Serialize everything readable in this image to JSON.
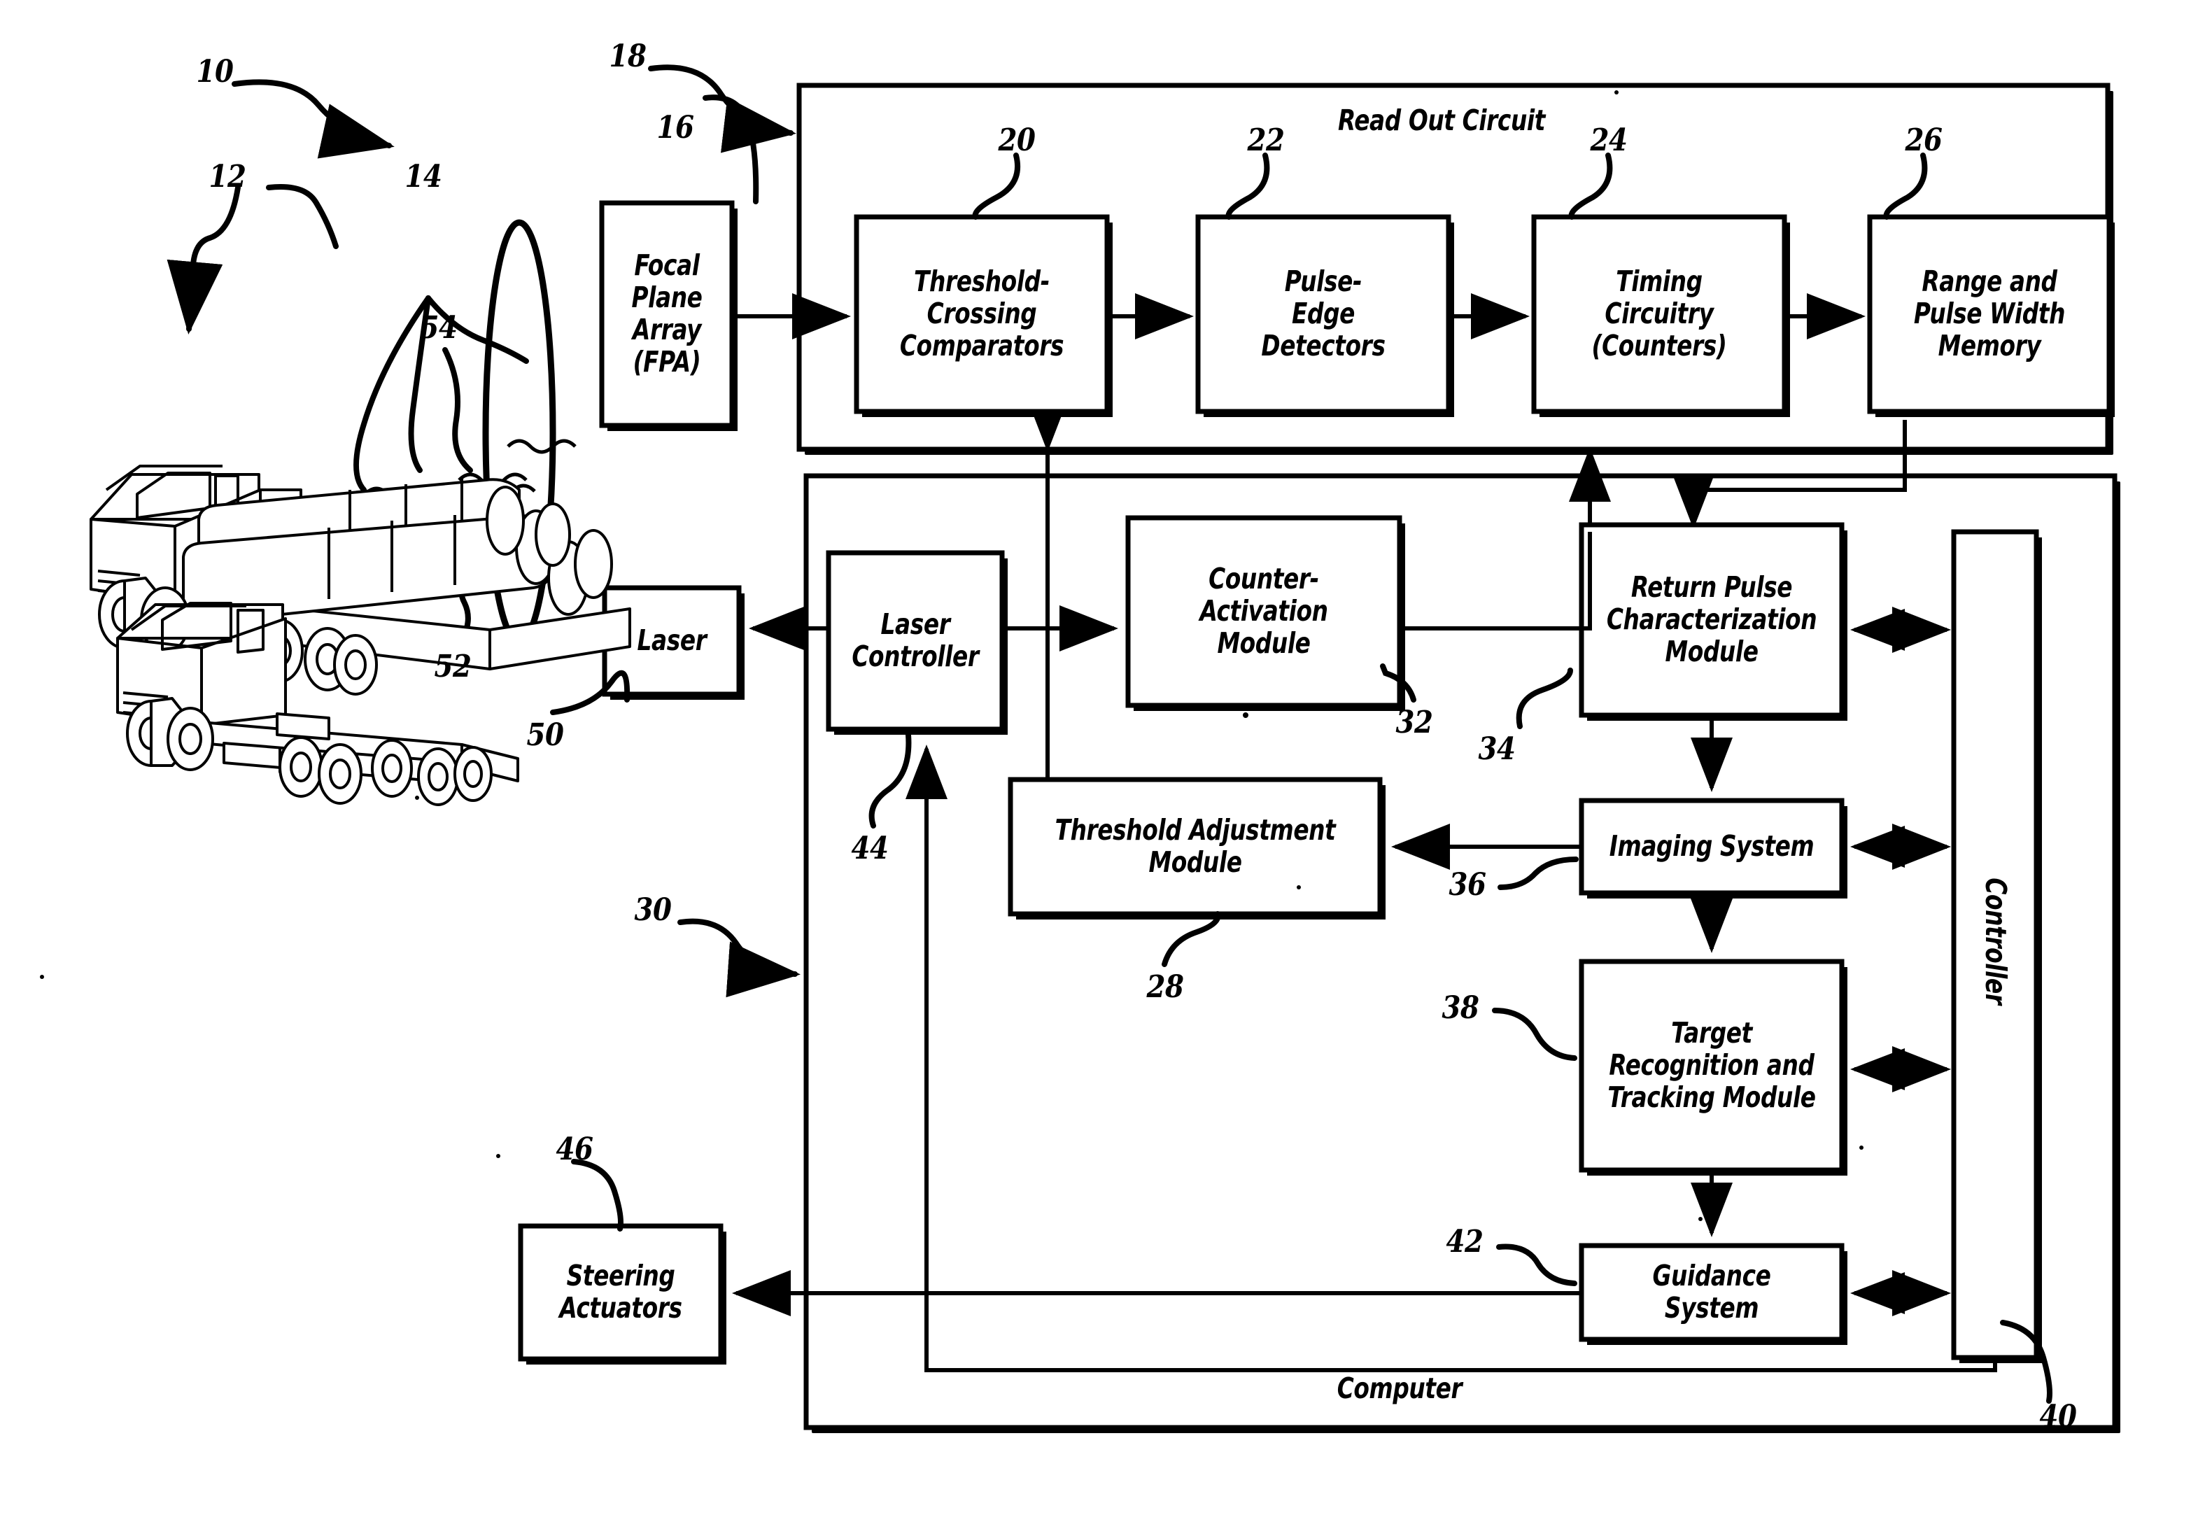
{
  "figure": {
    "domain": "patent-block-diagram",
    "line_color": "#000000",
    "background": "#ffffff"
  },
  "containers": [
    {
      "id": "read-out-circuit",
      "title": "Read Out Circuit",
      "ref": "18"
    },
    {
      "id": "computer",
      "title": "Computer",
      "ref": "30"
    }
  ],
  "blocks": [
    {
      "id": "fpa",
      "label": "Focal\nPlane\nArray\n(FPA)",
      "ref": "16"
    },
    {
      "id": "threshold",
      "label": "Threshold-\nCrossing\nComparators",
      "ref": "20"
    },
    {
      "id": "pulse-edge",
      "label": "Pulse-\nEdge\nDetectors",
      "ref": "22"
    },
    {
      "id": "timing",
      "label": "Timing\nCircuitry\n(Counters)",
      "ref": "24"
    },
    {
      "id": "range-memory",
      "label": "Range and\nPulse Width\nMemory",
      "ref": "26"
    },
    {
      "id": "laser",
      "label": "Laser",
      "ref": "50"
    },
    {
      "id": "laser-ctrl",
      "label": "Laser\nController",
      "ref": "44"
    },
    {
      "id": "counter-act",
      "label": "Counter-\nActivation\nModule",
      "ref": "32"
    },
    {
      "id": "return-pulse",
      "label": "Return Pulse\nCharacterization\nModule",
      "ref": "34"
    },
    {
      "id": "thresh-adj",
      "label": "Threshold Adjustment\nModule",
      "ref": "28"
    },
    {
      "id": "imaging",
      "label": "Imaging System",
      "ref": "36"
    },
    {
      "id": "target-rec",
      "label": "Target\nRecognition and\nTracking Module",
      "ref": "38"
    },
    {
      "id": "guidance",
      "label": "Guidance System",
      "ref": "42"
    },
    {
      "id": "controller",
      "label": "Controller",
      "ref": "40"
    },
    {
      "id": "steering",
      "label": "Steering\nActuators",
      "ref": "46"
    }
  ],
  "reference_numerals": [
    {
      "id": "ref-10",
      "value": "10",
      "points_to": "system-overall"
    },
    {
      "id": "ref-12",
      "value": "12",
      "points_to": "target-vehicles"
    },
    {
      "id": "ref-14",
      "value": "14",
      "points_to": "optics-lens"
    },
    {
      "id": "ref-16",
      "value": "16",
      "points_to": "fpa"
    },
    {
      "id": "ref-18",
      "value": "18",
      "points_to": "read-out-circuit"
    },
    {
      "id": "ref-20",
      "value": "20",
      "points_to": "threshold"
    },
    {
      "id": "ref-22",
      "value": "22",
      "points_to": "pulse-edge"
    },
    {
      "id": "ref-24",
      "value": "24",
      "points_to": "timing"
    },
    {
      "id": "ref-26",
      "value": "26",
      "points_to": "range-memory"
    },
    {
      "id": "ref-28",
      "value": "28",
      "points_to": "thresh-adj"
    },
    {
      "id": "ref-30",
      "value": "30",
      "points_to": "computer"
    },
    {
      "id": "ref-32",
      "value": "32",
      "points_to": "counter-act"
    },
    {
      "id": "ref-34",
      "value": "34",
      "points_to": "return-pulse"
    },
    {
      "id": "ref-36",
      "value": "36",
      "points_to": "imaging"
    },
    {
      "id": "ref-38",
      "value": "38",
      "points_to": "target-rec"
    },
    {
      "id": "ref-40",
      "value": "40",
      "points_to": "controller"
    },
    {
      "id": "ref-42",
      "value": "42",
      "points_to": "guidance"
    },
    {
      "id": "ref-44",
      "value": "44",
      "points_to": "laser-ctrl"
    },
    {
      "id": "ref-46",
      "value": "46",
      "points_to": "steering"
    },
    {
      "id": "ref-50",
      "value": "50",
      "points_to": "laser"
    },
    {
      "id": "ref-52",
      "value": "52",
      "points_to": "transmitted-beam"
    },
    {
      "id": "ref-54",
      "value": "54",
      "points_to": "return-pulse-rays"
    }
  ],
  "illustration": {
    "name": "target-vehicles",
    "items": [
      {
        "id": "missile-carrier-truck",
        "description": "flatbed truck carrying cylindrical canisters"
      },
      {
        "id": "cab-chassis-truck",
        "description": "cab-over truck chassis without load"
      }
    ],
    "optics": {
      "id": "lens",
      "shape": "narrow-vertical-ellipse"
    },
    "rays": [
      {
        "id": "return-rays",
        "ref": "54"
      },
      {
        "id": "transmit-ray",
        "ref": "52"
      }
    ]
  }
}
